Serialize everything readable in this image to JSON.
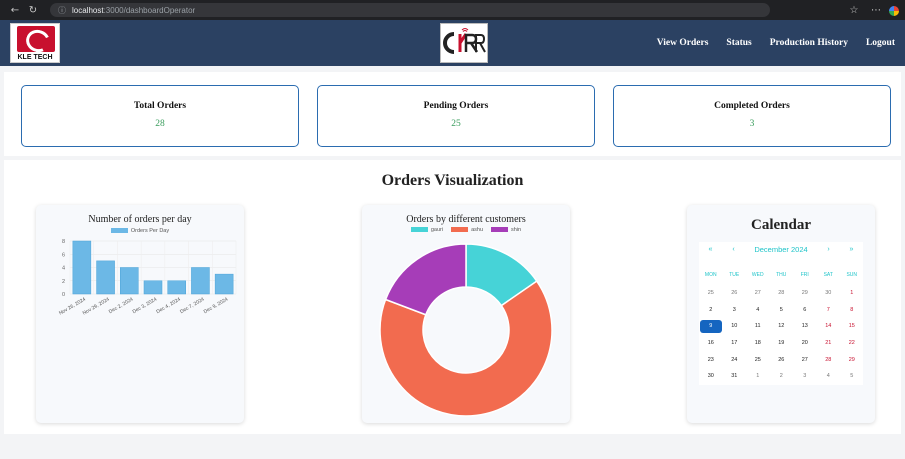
{
  "browser": {
    "url_host": "localhost",
    "url_path": ":3000/dashboardOperator"
  },
  "header": {
    "logo_text": "KLE TECH",
    "nav": [
      "View Orders",
      "Status",
      "Production History",
      "Logout"
    ],
    "brand_color": "#2b4162"
  },
  "stats": [
    {
      "title": "Total Orders",
      "value": "28"
    },
    {
      "title": "Pending Orders",
      "value": "25"
    },
    {
      "title": "Completed Orders",
      "value": "3"
    }
  ],
  "viz_title": "Orders Visualization",
  "chart_data": [
    {
      "type": "bar",
      "title": "Number of orders per day",
      "categories": [
        "Nov 26, 2024",
        "Nov 29, 2024",
        "Dec 2, 2024",
        "Dec 3, 2024",
        "Dec 4, 2024",
        "Dec 7, 2024",
        "Dec 9, 2024"
      ],
      "series": [
        {
          "name": "Orders Per Day",
          "values": [
            8,
            5,
            4,
            2,
            2,
            4,
            3
          ],
          "color": "#6cb8e6"
        }
      ],
      "ylim": [
        0,
        8
      ],
      "yticks": [
        0,
        2,
        4,
        6,
        8
      ],
      "grid": true,
      "legend": "top"
    },
    {
      "type": "pie",
      "title": "Orders by different customers",
      "categories": [
        "gauri",
        "ashu",
        "shin"
      ],
      "values": [
        4,
        17,
        5
      ],
      "colors": [
        "#46d3d7",
        "#f26b4f",
        "#a63db8"
      ],
      "donut": true,
      "legend": "top"
    }
  ],
  "calendar": {
    "title": "Calendar",
    "month": "December 2024",
    "nav_prev2": "«",
    "nav_prev": "‹",
    "nav_next": "›",
    "nav_next2": "»",
    "weekdays": [
      "MON",
      "TUE",
      "WED",
      "THU",
      "FRI",
      "SAT",
      "SUN"
    ],
    "days": [
      "25",
      "26",
      "27",
      "28",
      "29",
      "30",
      "1",
      "2",
      "3",
      "4",
      "5",
      "6",
      "7",
      "8",
      "9",
      "10",
      "11",
      "12",
      "13",
      "14",
      "15",
      "16",
      "17",
      "18",
      "19",
      "20",
      "21",
      "22",
      "23",
      "24",
      "25",
      "26",
      "27",
      "28",
      "29",
      "30",
      "31",
      "1",
      "2",
      "3",
      "4",
      "5"
    ],
    "selected": "9"
  }
}
